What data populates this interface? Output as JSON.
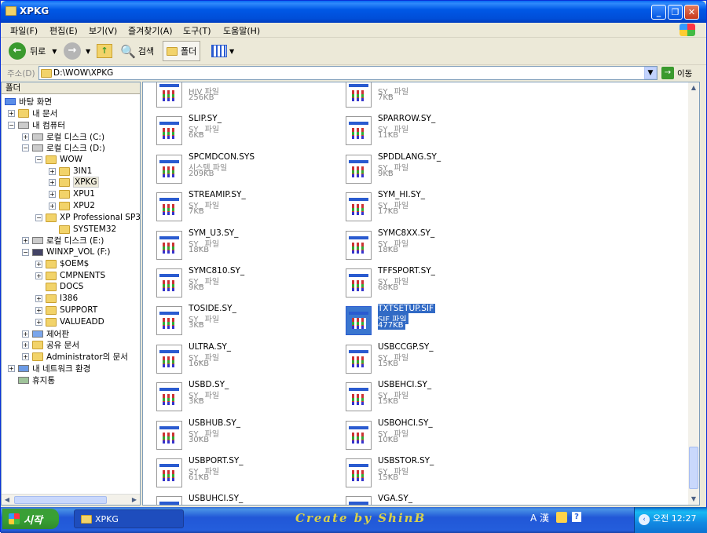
{
  "window": {
    "title": "XPKG"
  },
  "menu": [
    "파일(F)",
    "편집(E)",
    "보기(V)",
    "즐겨찾기(A)",
    "도구(T)",
    "도움말(H)"
  ],
  "toolbar": {
    "back": "뒤로",
    "search": "검색",
    "folders": "폴더"
  },
  "address": {
    "label": "주소(D)",
    "value": "D:\\WOW\\XPKG",
    "go": "이동"
  },
  "tree": {
    "header": "폴더",
    "items": [
      "바탕 화면",
      "내 문서",
      "내 컴퓨터",
      "로컬 디스크 (C:)",
      "로컬 디스크 (D:)",
      "WOW",
      "3IN1",
      "XPKG",
      "XPU1",
      "XPU2",
      "XP Professional SP3",
      "SYSTEM32",
      "로컬 디스크 (E:)",
      "WINXP_VOL (F:)",
      "$OEM$",
      "CMPNENTS",
      "DOCS",
      "I386",
      "SUPPORT",
      "VALUEADD",
      "제어판",
      "공유 문서",
      "Administrator의 문서",
      "내 네트워크 환경",
      "휴지통"
    ]
  },
  "files": [
    {
      "name": "",
      "type": "HIV 파일",
      "size": "256KB"
    },
    {
      "name": "",
      "type": "SY_ 파일",
      "size": "7KB"
    },
    {
      "name": "SLIP.SY_",
      "type": "SY_ 파일",
      "size": "6KB"
    },
    {
      "name": "SPARROW.SY_",
      "type": "SY_ 파일",
      "size": "11KB"
    },
    {
      "name": "SPCMDCON.SYS",
      "type": "시스템 파일",
      "size": "209KB"
    },
    {
      "name": "SPDDLANG.SY_",
      "type": "SY_ 파일",
      "size": "9KB"
    },
    {
      "name": "STREAMIP.SY_",
      "type": "SY_ 파일",
      "size": "7KB"
    },
    {
      "name": "SYM_HI.SY_",
      "type": "SY_ 파일",
      "size": "17KB"
    },
    {
      "name": "SYM_U3.SY_",
      "type": "SY_ 파일",
      "size": "18KB"
    },
    {
      "name": "SYMC8XX.SY_",
      "type": "SY_ 파일",
      "size": "18KB"
    },
    {
      "name": "SYMC810.SY_",
      "type": "SY_ 파일",
      "size": "9KB"
    },
    {
      "name": "TFFSPORT.SY_",
      "type": "SY_ 파일",
      "size": "68KB"
    },
    {
      "name": "TOSIDE.SY_",
      "type": "SY_ 파일",
      "size": "3KB"
    },
    {
      "name": "TXTSETUP.SIF",
      "type": "SIF 파일",
      "size": "477KB"
    },
    {
      "name": "ULTRA.SY_",
      "type": "SY_ 파일",
      "size": "16KB"
    },
    {
      "name": "USBCCGP.SY_",
      "type": "SY_ 파일",
      "size": "15KB"
    },
    {
      "name": "USBD.SY_",
      "type": "SY_ 파일",
      "size": "3KB"
    },
    {
      "name": "USBEHCI.SY_",
      "type": "SY_ 파일",
      "size": "15KB"
    },
    {
      "name": "USBHUB.SY_",
      "type": "SY_ 파일",
      "size": "30KB"
    },
    {
      "name": "USBOHCI.SY_",
      "type": "SY_ 파일",
      "size": "10KB"
    },
    {
      "name": "USBPORT.SY_",
      "type": "SY_ 파일",
      "size": "61KB"
    },
    {
      "name": "USBSTOR.SY_",
      "type": "SY_ 파일",
      "size": "15KB"
    },
    {
      "name": "USBUHCI.SY_",
      "type": "",
      "size": ""
    },
    {
      "name": "VGA.SY_",
      "type": "",
      "size": ""
    }
  ],
  "taskbar": {
    "start": "시작",
    "task": "XPKG",
    "credit": "Create by ShinB",
    "ime": "A 漢",
    "clock": "오전 12:27"
  },
  "colors": {
    "selection": "#316ac5",
    "title": "#0058e6",
    "taskbar": "#245edc",
    "start": "#38a035"
  }
}
